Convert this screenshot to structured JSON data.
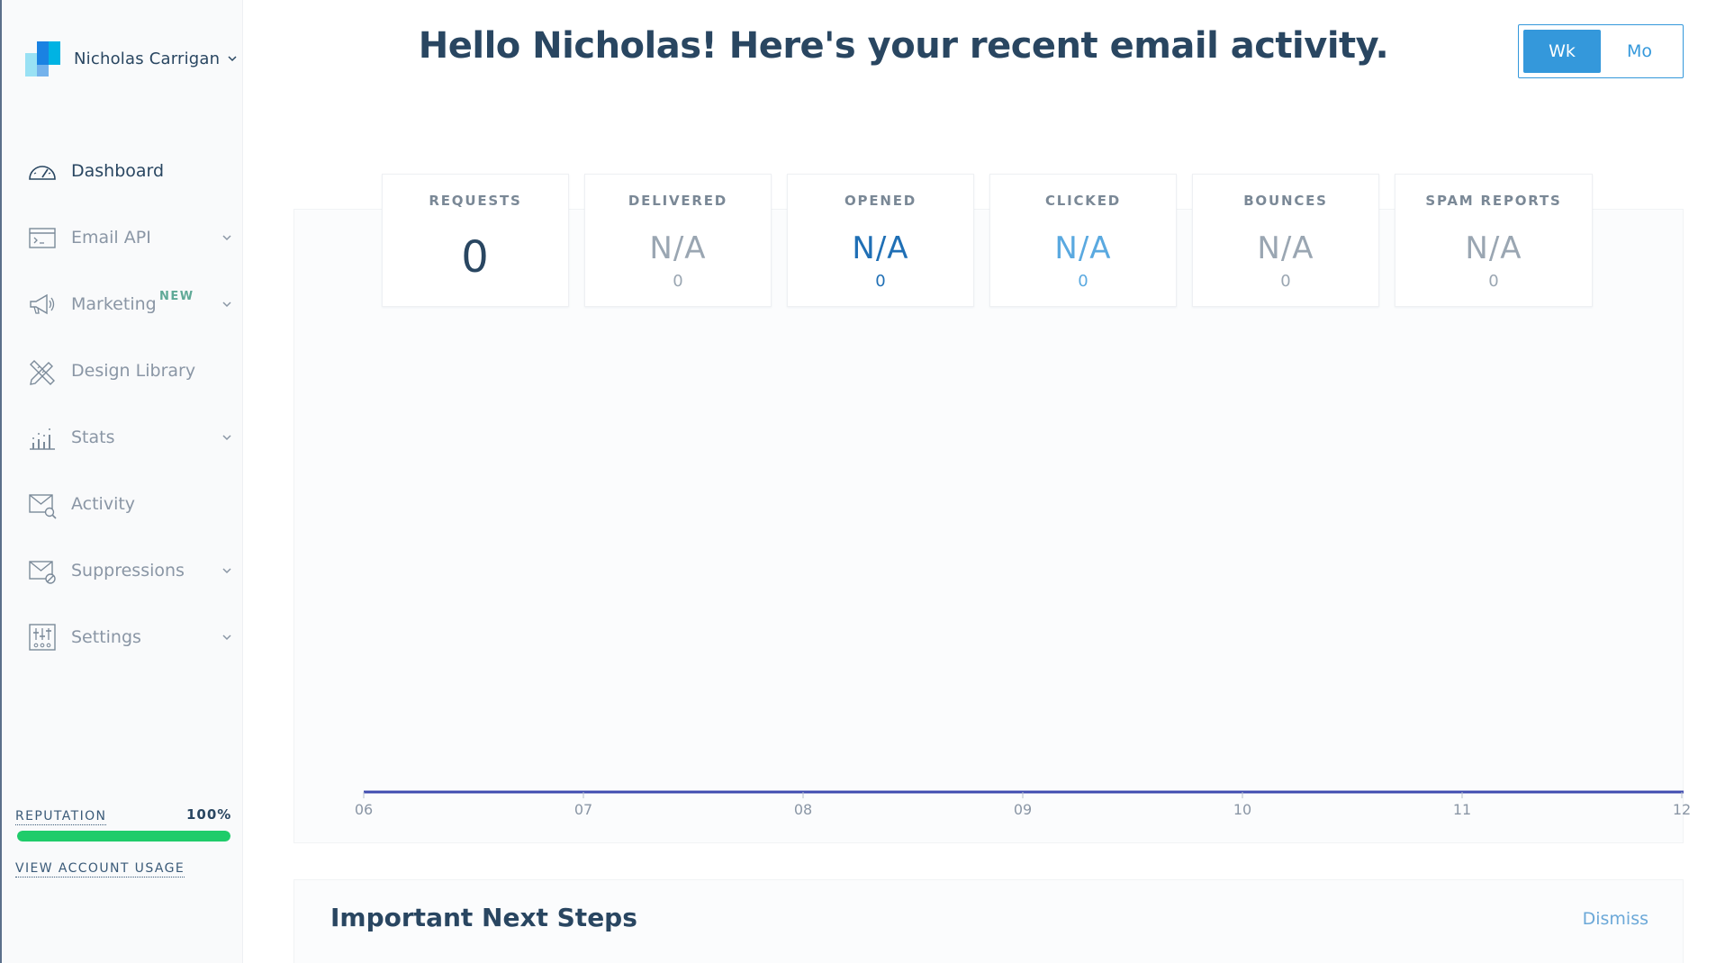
{
  "account": {
    "name": "Nicholas Carrigan"
  },
  "nav": [
    {
      "label": "Dashboard",
      "icon": "dashboard-gauge-icon",
      "active": true,
      "chevron": false
    },
    {
      "label": "Email API",
      "icon": "terminal-window-icon",
      "chevron": true
    },
    {
      "label": "Marketing",
      "icon": "megaphone-icon",
      "badge": "NEW",
      "chevron": true
    },
    {
      "label": "Design Library",
      "icon": "pencil-ruler-icon",
      "chevron": false
    },
    {
      "label": "Stats",
      "icon": "bar-chart-icon",
      "chevron": true
    },
    {
      "label": "Activity",
      "icon": "envelope-search-icon",
      "chevron": false
    },
    {
      "label": "Suppressions",
      "icon": "envelope-block-icon",
      "chevron": true
    },
    {
      "label": "Settings",
      "icon": "sliders-icon",
      "chevron": true
    }
  ],
  "reputation": {
    "label": "REPUTATION",
    "value": "100%",
    "fraction": 1.0
  },
  "usage_link": "VIEW ACCOUNT USAGE",
  "title": "Hello Nicholas! Here's your recent email activity.",
  "period_toggle": {
    "options": [
      "Wk",
      "Mo"
    ],
    "selected": "Wk"
  },
  "stats": [
    {
      "title": "REQUESTS",
      "value": "0",
      "sub": ""
    },
    {
      "title": "DELIVERED",
      "value": "N/A",
      "sub": "0"
    },
    {
      "title": "OPENED",
      "value": "N/A",
      "sub": "0"
    },
    {
      "title": "CLICKED",
      "value": "N/A",
      "sub": "0"
    },
    {
      "title": "BOUNCES",
      "value": "N/A",
      "sub": "0"
    },
    {
      "title": "SPAM REPORTS",
      "value": "N/A",
      "sub": "0"
    }
  ],
  "colors": {
    "accent": "#3498db",
    "stat_value": [
      "#294661",
      "#9aa6b2",
      "#1f6fb5",
      "#5aa9e0",
      "#9aa6b2",
      "#9aa6b2"
    ],
    "reputation_bar": "#1fcc6a",
    "series_line": "#3f4bb0"
  },
  "chart_data": {
    "type": "line",
    "categories": [
      "06",
      "07",
      "08",
      "09",
      "10",
      "11",
      "12"
    ],
    "series": [
      {
        "values": [
          0,
          0,
          0,
          0,
          0,
          0,
          0
        ]
      }
    ],
    "title": "",
    "xlabel": "",
    "ylabel": ""
  },
  "next_steps": {
    "title": "Important Next Steps",
    "dismiss_label": "Dismiss"
  }
}
